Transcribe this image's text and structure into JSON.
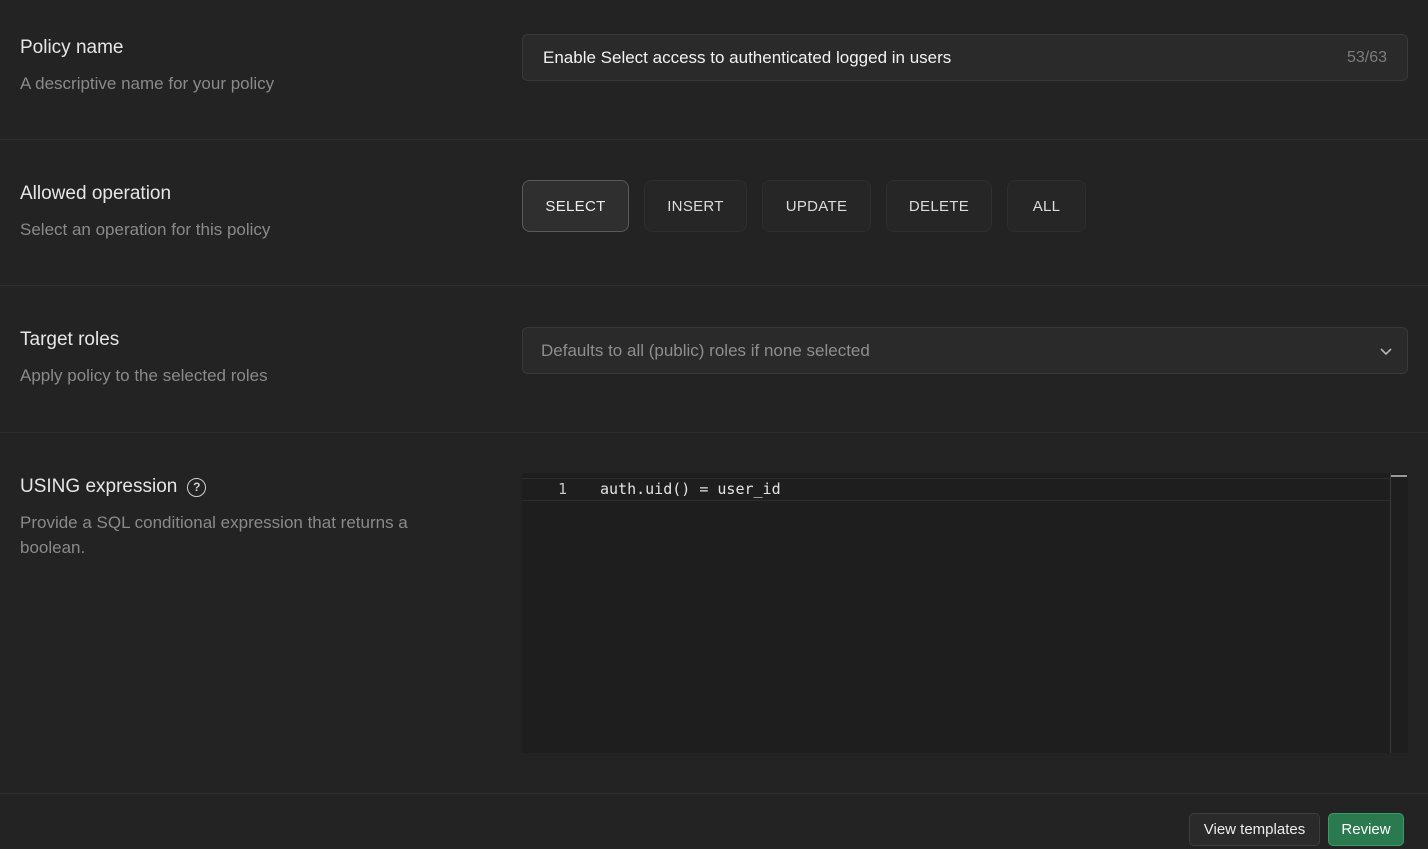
{
  "policy_name": {
    "title": "Policy name",
    "description": "A descriptive name for your policy",
    "value": "Enable Select access to authenticated logged in users",
    "counter": "53/63"
  },
  "operation": {
    "title": "Allowed operation",
    "description": "Select an operation for this policy",
    "options": [
      "SELECT",
      "INSERT",
      "UPDATE",
      "DELETE",
      "ALL"
    ],
    "selected": "SELECT"
  },
  "target_roles": {
    "title": "Target roles",
    "description": "Apply policy to the selected roles",
    "placeholder": "Defaults to all (public) roles if none selected"
  },
  "using_expression": {
    "title": "USING expression",
    "help_icon": "?",
    "description": "Provide a SQL conditional expression that returns a boolean.",
    "line_number": "1",
    "code": "auth.uid() = user_id"
  },
  "footer": {
    "view_templates_label": "View templates",
    "review_label": "Review"
  },
  "colors": {
    "background": "#232323",
    "review_button": "#2b7a4f"
  }
}
